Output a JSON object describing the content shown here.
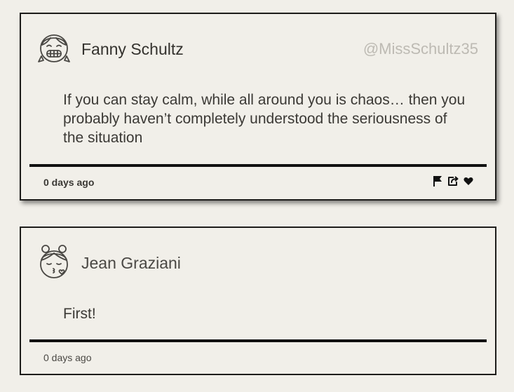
{
  "posts": [
    {
      "author": "Fanny Schultz",
      "handle": "@MissSchultz35",
      "avatar_icon": "grinning-girl-icon",
      "text": "If you can stay calm, while all around you is chaos… then you probably haven’t completely understood the seriousness of the situation",
      "timestamp": "0 days ago",
      "actions": [
        "flag-icon",
        "share-icon",
        "heart-icon"
      ]
    },
    {
      "author": "Jean Graziani",
      "avatar_icon": "kissing-girl-icon",
      "text": "First!",
      "timestamp": "0 days ago"
    }
  ],
  "colors": {
    "background": "#f1efe9",
    "border": "#1d1c1a",
    "handle": "#bdbab3",
    "text": "#3b3935"
  }
}
